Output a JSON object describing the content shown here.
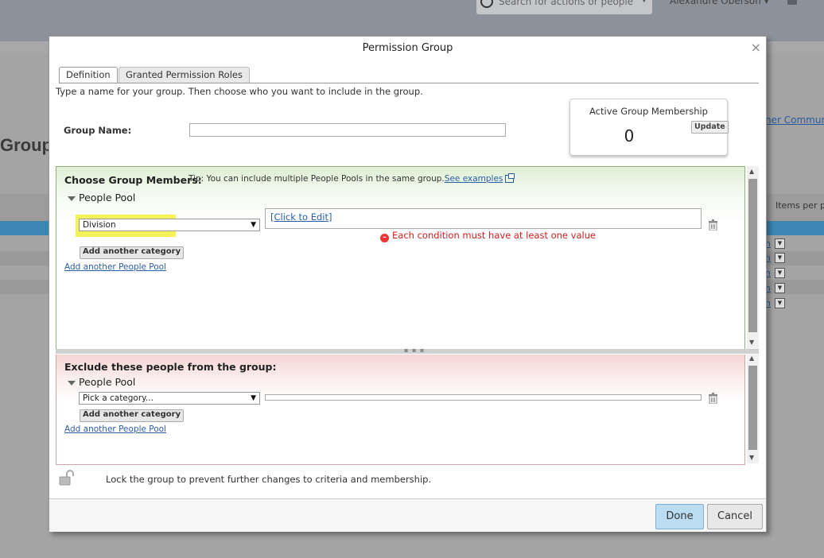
{
  "background": {
    "search_placeholder": "Search for actions or people",
    "user_name": "Alexandre Oberson",
    "page_title": "Group",
    "side_link": "ner Communi",
    "items_per_page": "Items per pa",
    "row_link": "n"
  },
  "dialog": {
    "title": "Permission Group",
    "close_glyph": "×",
    "tabs": [
      {
        "label": "Definition"
      },
      {
        "label": "Granted Permission Roles"
      }
    ],
    "intro": "Type a name for your group. Then choose who you want to include in the group.",
    "group_name_label": "Group Name:",
    "group_name_value": "",
    "membership": {
      "title": "Active Group Membership",
      "count": "0",
      "update_label": "Update"
    },
    "include": {
      "heading": "Choose Group Members:",
      "tip": "Tip: You can include multiple People Pools in the same group.",
      "tip_link": "See examples",
      "pool_label": "People Pool",
      "category_value": "Division",
      "click_to_edit": "[Click to Edit]",
      "error": "Each condition must have at least one value",
      "add_category": "Add another category",
      "add_pool": "Add another People Pool"
    },
    "exclude": {
      "heading": "Exclude these people from the group:",
      "pool_label": "People Pool",
      "category_placeholder": "Pick a category...",
      "add_category": "Add another category",
      "add_pool": "Add another People Pool"
    },
    "lock_text": "Lock the group to prevent further changes to criteria and membership.",
    "buttons": {
      "done": "Done",
      "cancel": "Cancel"
    }
  },
  "colors": {
    "highlight": "#f6f25a",
    "error": "#d02020",
    "link": "#2b5ea8",
    "done_button": "#bcdcf2"
  },
  "icons": {
    "close": "close-icon",
    "trash": "trash-icon",
    "lock": "unlock-icon",
    "error": "error-circle-icon",
    "external": "external-link-icon"
  }
}
